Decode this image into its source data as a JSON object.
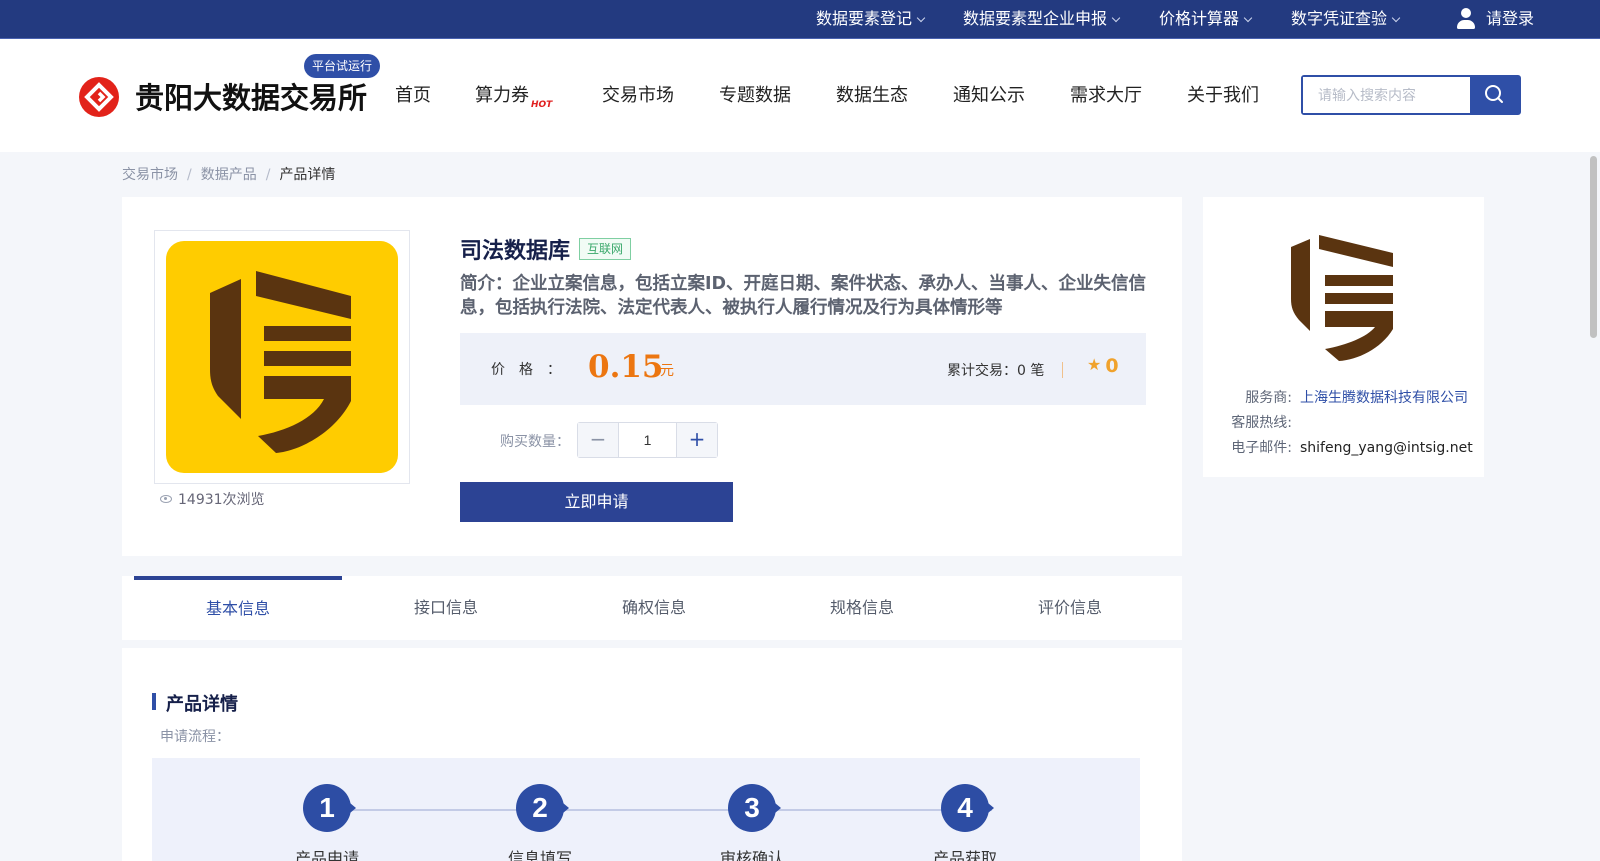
{
  "topbar": {
    "items": [
      {
        "label": "数据要素登记"
      },
      {
        "label": "数据要素型企业申报"
      },
      {
        "label": "价格计算器"
      },
      {
        "label": "数字凭证查验"
      }
    ],
    "login": "请登录",
    "bg_color": "#233a80"
  },
  "header": {
    "title": "贵阳大数据交易所",
    "badge": "平台试运行",
    "nav": [
      {
        "label": "首页"
      },
      {
        "label": "算力券",
        "badge": "HOT"
      },
      {
        "label": "交易市场"
      },
      {
        "label": "专题数据"
      },
      {
        "label": "数据生态"
      },
      {
        "label": "通知公示"
      },
      {
        "label": "需求大厅"
      },
      {
        "label": "关于我们"
      }
    ],
    "search": {
      "placeholder": "请输入搜索内容",
      "value": ""
    }
  },
  "breadcrumb": {
    "items": [
      "交易市场",
      "数据产品"
    ],
    "current": "产品详情",
    "separator": "/"
  },
  "product": {
    "title": "司法数据库",
    "tag": "互联网",
    "description": "简介：企业立案信息，包括立案ID、开庭日期、案件状态、承办人、当事人、企业失信信息，包括执行法院、法定代表人、被执行人履行情况及行为具体情形等",
    "price_label": "价格：",
    "price": "0.15",
    "price_unit": "元",
    "trade_count": "累计交易：0 笔",
    "rating": "0",
    "views": "14931次浏览",
    "qty_label": "购买数量：",
    "qty_minus": "−",
    "qty_plus": "+",
    "qty_value": "1",
    "apply_label": "立即申请",
    "accent_color": "#ec7611"
  },
  "provider": {
    "service_label": "服务商:",
    "service_value": "上海生腾数据科技有限公司",
    "hotline_label": "客服热线:",
    "hotline_value": "",
    "email_label": "电子邮件:",
    "email_value": "shifeng_yang@intsig.net"
  },
  "tabs": [
    {
      "label": "基本信息",
      "active": true
    },
    {
      "label": "接口信息",
      "active": false
    },
    {
      "label": "确权信息",
      "active": false
    },
    {
      "label": "规格信息",
      "active": false
    },
    {
      "label": "评价信息",
      "active": false
    }
  ],
  "detail": {
    "title": "产品详情",
    "flow_label": "申请流程：",
    "steps": [
      {
        "num": "1",
        "label": "产品申请"
      },
      {
        "num": "2",
        "label": "信息填写"
      },
      {
        "num": "3",
        "label": "审核确认"
      },
      {
        "num": "4",
        "label": "产品获取"
      }
    ]
  }
}
